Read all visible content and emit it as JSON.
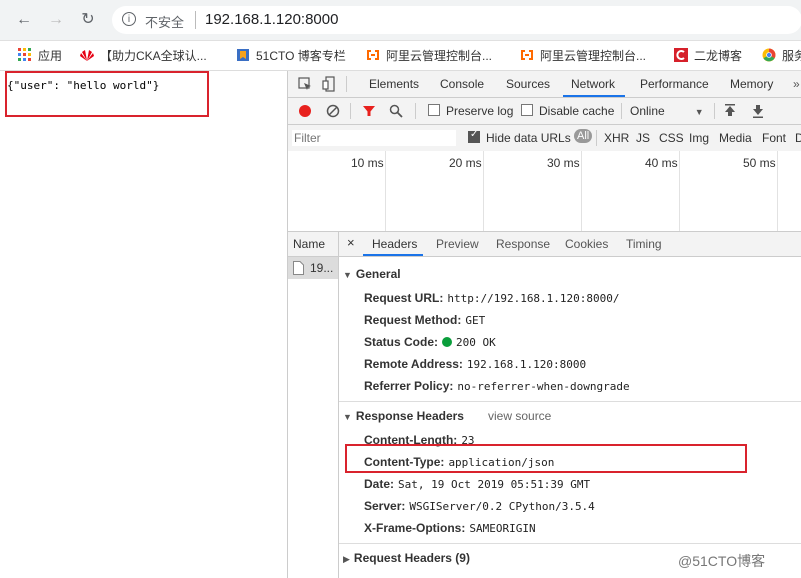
{
  "browser": {
    "insecure_label": "不安全",
    "url": "192.168.1.120:8000"
  },
  "bookmarks": [
    {
      "label": "应用",
      "icon": "apps-grid-icon"
    },
    {
      "label": "【助力CKA全球认...",
      "icon": "huawei-logo-icon"
    },
    {
      "label": "51CTO 博客专栏",
      "icon": "bookmark-icon"
    },
    {
      "label": "阿里云管理控制台...",
      "icon": "aliyun-icon"
    },
    {
      "label": "阿里云管理控制台...",
      "icon": "aliyun-icon"
    },
    {
      "label": "二龙博客",
      "icon": "blog-icon"
    },
    {
      "label": "服务",
      "icon": "chrome-icon"
    }
  ],
  "page": {
    "json_text": "{\"user\": \"hello world\"}"
  },
  "devtools": {
    "tabs": [
      "Elements",
      "Console",
      "Sources",
      "Network",
      "Performance",
      "Memory"
    ],
    "toolbar": {
      "preserve_log": "Preserve log",
      "disable_cache": "Disable cache",
      "throttle": "Online"
    },
    "filter": {
      "placeholder": "Filter",
      "hide_data_urls": "Hide data URLs",
      "all": "All",
      "types": [
        "XHR",
        "JS",
        "CSS",
        "Img",
        "Media",
        "Font",
        "D"
      ]
    },
    "timeline_ticks": [
      "10 ms",
      "20 ms",
      "30 ms",
      "40 ms",
      "50 ms"
    ],
    "name_header": "Name",
    "request_name": "19...",
    "detail_tabs": [
      "Headers",
      "Preview",
      "Response",
      "Cookies",
      "Timing"
    ],
    "general": {
      "title": "General",
      "rows": [
        {
          "k": "Request URL:",
          "v": "http://192.168.1.120:8000/"
        },
        {
          "k": "Request Method:",
          "v": "GET"
        },
        {
          "k": "Status Code:",
          "v": "200 OK"
        },
        {
          "k": "Remote Address:",
          "v": "192.168.1.120:8000"
        },
        {
          "k": "Referrer Policy:",
          "v": "no-referrer-when-downgrade"
        }
      ]
    },
    "response_headers": {
      "title": "Response Headers",
      "view_source": "view source",
      "rows": [
        {
          "k": "Content-Length:",
          "v": "23"
        },
        {
          "k": "Content-Type:",
          "v": "application/json"
        },
        {
          "k": "Date:",
          "v": "Sat, 19 Oct 2019 05:51:39 GMT"
        },
        {
          "k": "Server:",
          "v": "WSGIServer/0.2 CPython/3.5.4"
        },
        {
          "k": "X-Frame-Options:",
          "v": "SAMEORIGIN"
        }
      ]
    },
    "request_headers": {
      "title": "Request Headers (9)"
    }
  },
  "watermark": "@51CTO博客",
  "colors": {
    "highlight": "#d9232d",
    "accent": "#1a73e8",
    "record": "#e8211e",
    "status_ok": "#0a9e3b"
  }
}
